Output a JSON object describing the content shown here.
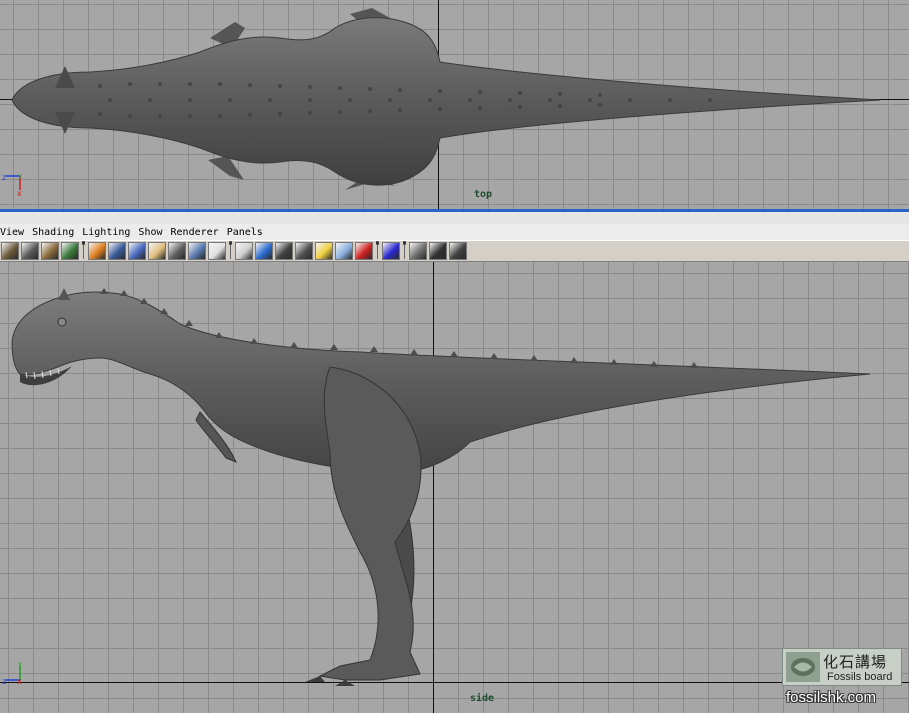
{
  "viewports": {
    "top": {
      "label": "top"
    },
    "side": {
      "label": "side"
    }
  },
  "menu": {
    "items": [
      "View",
      "Shading",
      "Lighting",
      "Show",
      "Renderer",
      "Panels"
    ]
  },
  "toolbar": {
    "buttons": [
      {
        "icon": "select-camera-icon",
        "color": "#6b5a3a"
      },
      {
        "icon": "film-camera-icon",
        "color": "#5a5a5a"
      },
      {
        "icon": "bookmark-icon",
        "color": "#8a6a3a"
      },
      {
        "icon": "layers-icon",
        "color": "#3a7a3a"
      },
      {
        "sep": true
      },
      {
        "icon": "grid-toggle-icon",
        "color": "#e08020"
      },
      {
        "icon": "film-gate-icon",
        "color": "#3a5a9a"
      },
      {
        "icon": "resolution-gate-icon",
        "color": "#4a6ac0"
      },
      {
        "icon": "safe-action-icon",
        "color": "#e0c080"
      },
      {
        "icon": "field-chart-icon",
        "color": "#606060"
      },
      {
        "icon": "image-plane-icon",
        "color": "#5a7ab0"
      },
      {
        "icon": "text-icon",
        "color": "#e0e0e0"
      },
      {
        "sep": true
      },
      {
        "icon": "wireframe-icon",
        "color": "#d0d0d0"
      },
      {
        "icon": "smooth-shade-icon",
        "color": "#2a6ad0"
      },
      {
        "icon": "flat-shade-icon",
        "color": "#404040"
      },
      {
        "icon": "bounding-box-icon",
        "color": "#505050"
      },
      {
        "icon": "light-bulb-icon",
        "color": "#f0d040"
      },
      {
        "icon": "texture-icon",
        "color": "#8ab0e0"
      },
      {
        "icon": "shadow-icon",
        "color": "#d02020"
      },
      {
        "sep": true
      },
      {
        "icon": "isolate-select-icon",
        "color": "#2a2ad0"
      },
      {
        "sep": true
      },
      {
        "icon": "xray-icon",
        "color": "#707070"
      },
      {
        "icon": "frame-all-icon",
        "color": "#303030"
      },
      {
        "icon": "joint-xray-icon",
        "color": "#404040"
      }
    ]
  },
  "watermark": {
    "chinese": "化石講場",
    "english": "Fossils board",
    "url": "fossilshk.com"
  },
  "colors": {
    "viewport_bg": "#a6a6a6",
    "grid": "#8a8a8a",
    "panel_border": "#2a62c9",
    "model": "#5d5d5d",
    "axis_x": "#cc2020",
    "axis_y": "#20a020",
    "axis_z": "#2040d0"
  }
}
